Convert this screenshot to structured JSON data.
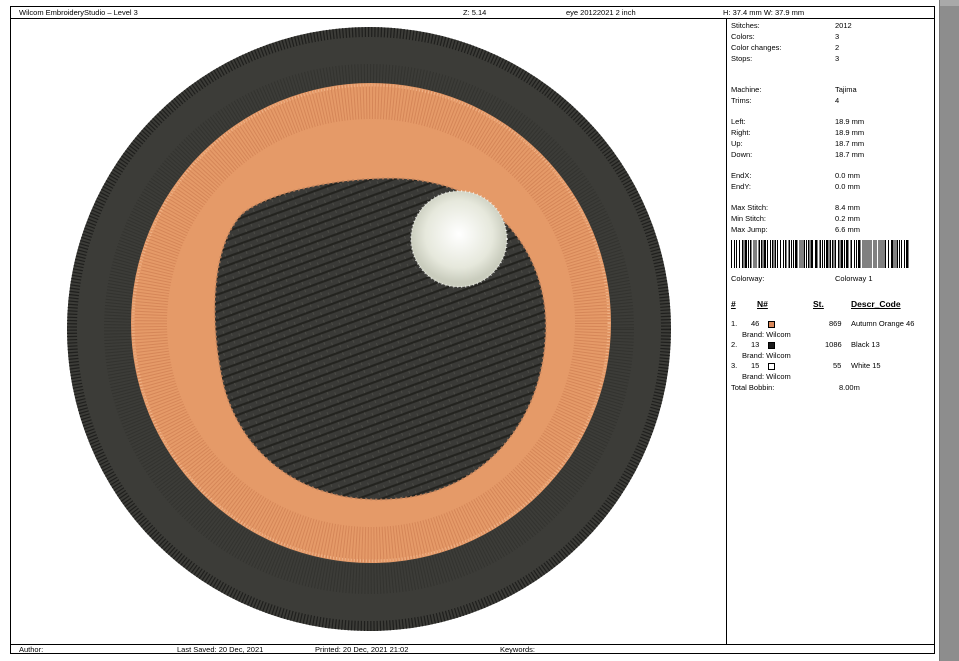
{
  "header": {
    "app_title": "Wilcom EmbroideryStudio – Level 3",
    "zoom": "Z: 5.14",
    "design_name": "eye  20122021 2 inch",
    "size": "H: 37.4 mm   W: 37.9 mm"
  },
  "stats": {
    "stitches_label": "Stitches:",
    "stitches": "2012",
    "colors_label": "Colors:",
    "colors": "3",
    "color_changes_label": "Color changes:",
    "color_changes": "2",
    "stops_label": "Stops:",
    "stops": "3",
    "machine_label": "Machine:",
    "machine": "Tajima",
    "trims_label": "Trims:",
    "trims": "4",
    "left_label": "Left:",
    "left": "18.9 mm",
    "right_label": "Right:",
    "right": "18.9 mm",
    "up_label": "Up:",
    "up": "18.7 mm",
    "down_label": "Down:",
    "down": "18.7 mm",
    "endx_label": "EndX:",
    "endx": "0.0 mm",
    "endy_label": "EndY:",
    "endy": "0.0 mm",
    "max_stitch_label": "Max Stitch:",
    "max_stitch": "8.4 mm",
    "min_stitch_label": "Min Stitch:",
    "min_stitch": "0.2 mm",
    "max_jump_label": "Max Jump:",
    "max_jump": "6.6 mm",
    "colorway_label": "Colorway:",
    "colorway": "Colorway 1"
  },
  "colors_table": {
    "headers": {
      "index": "#",
      "number": "N#",
      "stitches": "St.",
      "descr": "Descr_Code"
    },
    "rows": [
      {
        "index": "1.",
        "number": "46",
        "swatch": "#d9885a",
        "stitches": "869",
        "descr": "Autumn Orange 46",
        "brand": "Brand: Wilcom"
      },
      {
        "index": "2.",
        "number": "13",
        "swatch": "#1a1a1a",
        "stitches": "1086",
        "descr": "Black 13",
        "brand": "Brand: Wilcom"
      },
      {
        "index": "3.",
        "number": "15",
        "swatch": "#ffffff",
        "stitches": "55",
        "descr": "White 15",
        "brand": "Brand: Wilcom"
      }
    ],
    "total_bobbin_label": "Total Bobbin:",
    "total_bobbin": "8.00m"
  },
  "footer": {
    "author": "Author:",
    "last_saved": "Last Saved: 20 Dec, 2021",
    "printed": "Printed: 20 Dec, 2021 21:02",
    "keywords": "Keywords:"
  },
  "palette": {
    "outer_ring": "#3c3c38",
    "orange_ring": "#e59a68",
    "pupil": "#343431",
    "highlight": "#e9eadf"
  }
}
